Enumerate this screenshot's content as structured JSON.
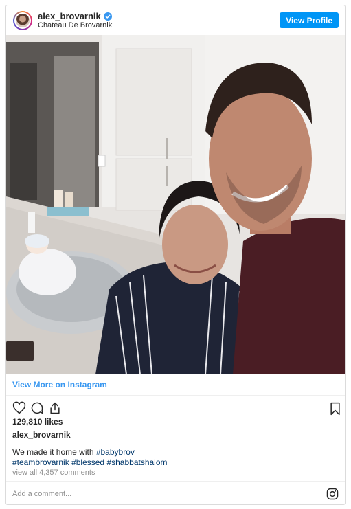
{
  "post": {
    "username": "alex_brovarnik",
    "location": "Chateau De Brovarnik",
    "view_profile_label": "View Profile",
    "view_more_label": "View More on Instagram",
    "likes": "129,810 likes",
    "caption_user": "alex_brovarnik",
    "caption_text": "We made it home with ",
    "hashtags": [
      "#babybrov",
      "#teambrovarnik",
      "#blessed",
      "#shabbatshalom"
    ],
    "view_comments": "view all 4,357 comments",
    "add_comment_placeholder": "Add a comment..."
  },
  "icons": {
    "verified": "verified-badge-icon",
    "like": "heart-icon",
    "comment": "comment-icon",
    "share": "share-icon",
    "save": "bookmark-icon",
    "instagram": "instagram-logo-icon"
  },
  "colors": {
    "accent": "#0095f6",
    "link": "#3897f0",
    "hashtag": "#00376b",
    "muted": "#8e8e8e",
    "border": "#dbdbdb"
  }
}
